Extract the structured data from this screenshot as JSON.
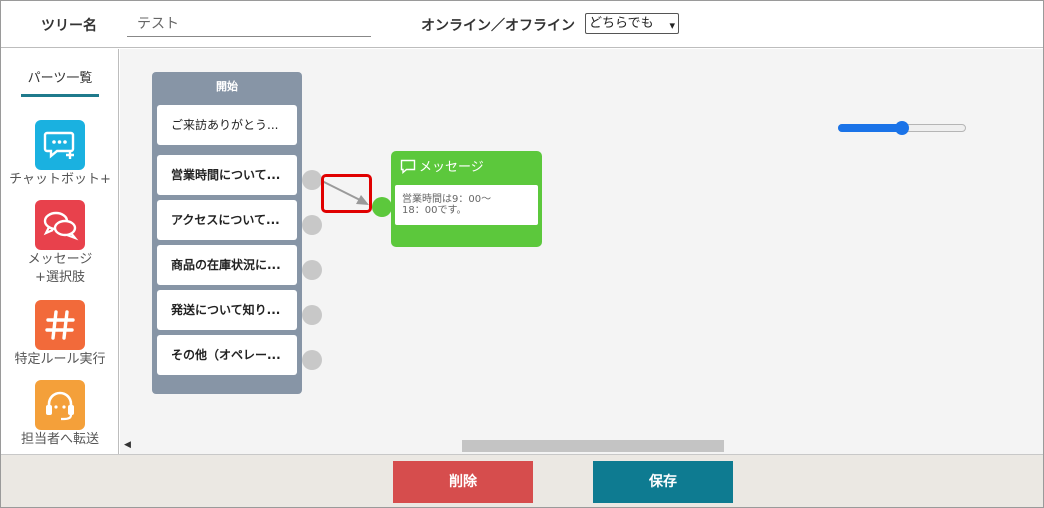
{
  "header": {
    "tree_name_label": "ツリー名",
    "tree_name_value": "テスト",
    "online_label": "オンライン／オフライン",
    "online_select_value": "どちらでも"
  },
  "sidebar": {
    "title": "パーツ一覧",
    "parts": [
      {
        "label": "チャットボット+",
        "icon": "chat-plus-icon",
        "color": "#1ab1e0"
      },
      {
        "label": "メッセージ\n+選択肢",
        "icon": "speech-bubbles-icon",
        "color": "#e8414c"
      },
      {
        "label": "特定ルール実行",
        "icon": "hash-icon",
        "color": "#f26a3a"
      },
      {
        "label": "担当者へ転送",
        "icon": "headset-icon",
        "color": "#f4a03a"
      }
    ]
  },
  "canvas": {
    "start_node": {
      "title": "開始",
      "options": [
        "ご来訪ありがとう...",
        "営業時間について...",
        "アクセスについて...",
        "商品の在庫状況に...",
        "発送について知り...",
        "その他（オペレー..."
      ]
    },
    "message_node": {
      "title": "メッセージ",
      "body_line1": "営業時間は9：00～",
      "body_line2": "18：00です。"
    },
    "zoom_slider_level": 0.5
  },
  "footer": {
    "delete_label": "削除",
    "save_label": "保存"
  },
  "colors": {
    "start_node": "#8795a6",
    "message_node": "#5cc83c",
    "delete_button": "#d64d4d",
    "save_button": "#0e7b91",
    "highlight": "#e00000"
  }
}
